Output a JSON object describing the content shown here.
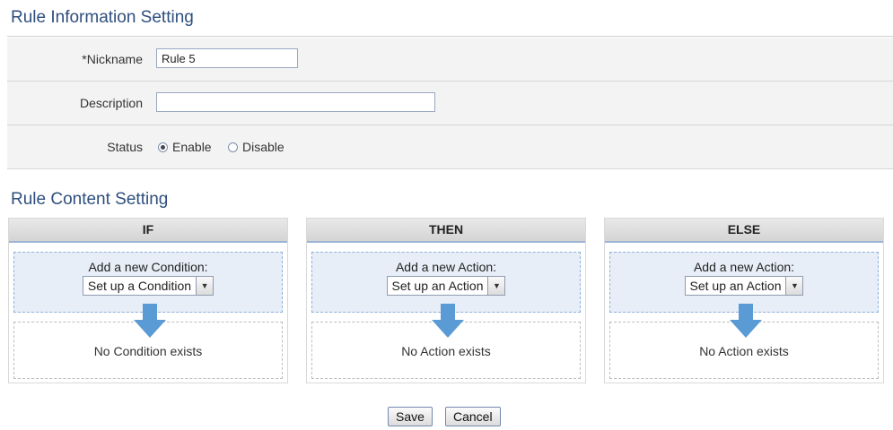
{
  "rule_info": {
    "title": "Rule Information Setting",
    "nickname_label": "*Nickname",
    "nickname_value": "Rule 5",
    "description_label": "Description",
    "description_value": "",
    "status_label": "Status",
    "status_options": [
      "Enable",
      "Disable"
    ],
    "status_selected": "Enable"
  },
  "rule_content": {
    "title": "Rule Content Setting",
    "columns": [
      {
        "header": "IF",
        "add_label": "Add a new Condition:",
        "select_value": "Set up a Condition",
        "empty_text": "No Condition exists"
      },
      {
        "header": "THEN",
        "add_label": "Add a new Action:",
        "select_value": "Set up an Action",
        "empty_text": "No Action exists"
      },
      {
        "header": "ELSE",
        "add_label": "Add a new Action:",
        "select_value": "Set up an Action",
        "empty_text": "No Action exists"
      }
    ]
  },
  "buttons": {
    "save": "Save",
    "cancel": "Cancel"
  },
  "colors": {
    "title": "#2e4f7d",
    "arrow": "#5b9bd5",
    "add_box_bg": "#e8eef7"
  },
  "icons": {
    "dropdown": "chevron-down-icon",
    "flow_arrow": "arrow-down-icon"
  }
}
